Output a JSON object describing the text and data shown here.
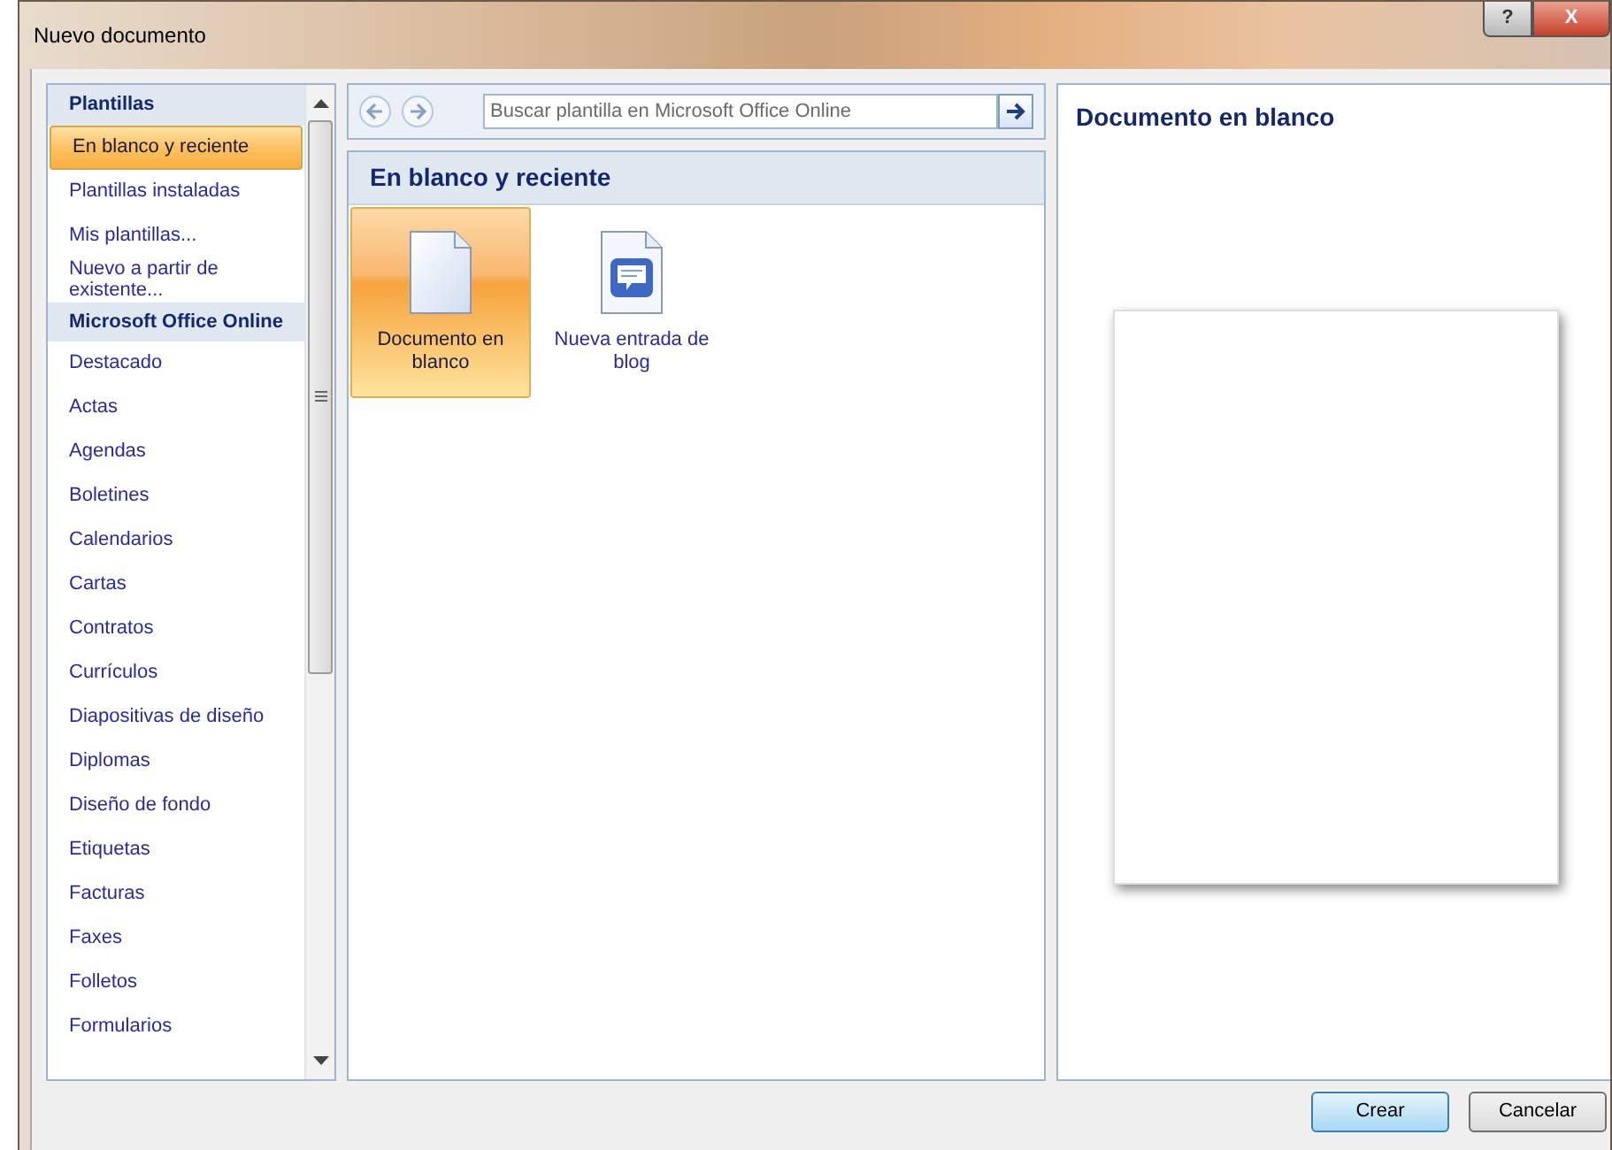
{
  "window": {
    "title": "Nuevo documento",
    "help_button": "?",
    "close_button": "X"
  },
  "sidebar": {
    "items": [
      {
        "kind": "header",
        "label": "Plantillas"
      },
      {
        "kind": "item",
        "label": "En blanco y reciente",
        "selected": true
      },
      {
        "kind": "item",
        "label": "Plantillas instaladas",
        "selected": false
      },
      {
        "kind": "item",
        "label": "Mis plantillas...",
        "selected": false
      },
      {
        "kind": "item",
        "label": "Nuevo a partir de existente...",
        "selected": false
      },
      {
        "kind": "header",
        "label": "Microsoft Office Online"
      },
      {
        "kind": "item",
        "label": "Destacado",
        "selected": false
      },
      {
        "kind": "item",
        "label": "Actas",
        "selected": false
      },
      {
        "kind": "item",
        "label": "Agendas",
        "selected": false
      },
      {
        "kind": "item",
        "label": "Boletines",
        "selected": false
      },
      {
        "kind": "item",
        "label": "Calendarios",
        "selected": false
      },
      {
        "kind": "item",
        "label": "Cartas",
        "selected": false
      },
      {
        "kind": "item",
        "label": "Contratos",
        "selected": false
      },
      {
        "kind": "item",
        "label": "Currículos",
        "selected": false
      },
      {
        "kind": "item",
        "label": "Diapositivas de diseño",
        "selected": false
      },
      {
        "kind": "item",
        "label": "Diplomas",
        "selected": false
      },
      {
        "kind": "item",
        "label": "Diseño de fondo",
        "selected": false
      },
      {
        "kind": "item",
        "label": "Etiquetas",
        "selected": false
      },
      {
        "kind": "item",
        "label": "Facturas",
        "selected": false
      },
      {
        "kind": "item",
        "label": "Faxes",
        "selected": false
      },
      {
        "kind": "item",
        "label": "Folletos",
        "selected": false
      },
      {
        "kind": "item",
        "label": "Formularios",
        "selected": false
      }
    ]
  },
  "search": {
    "placeholder": "Buscar plantilla en Microsoft Office Online"
  },
  "gallery": {
    "title": "En blanco y reciente",
    "items": [
      {
        "kind": "blank",
        "label": "Documento en blanco",
        "selected": true
      },
      {
        "kind": "blog",
        "label": "Nueva entrada de blog",
        "selected": false
      }
    ]
  },
  "preview": {
    "title": "Documento en blanco"
  },
  "buttons": [
    {
      "label": "Crear",
      "default": true
    },
    {
      "label": "Cancelar",
      "default": false
    }
  ]
}
